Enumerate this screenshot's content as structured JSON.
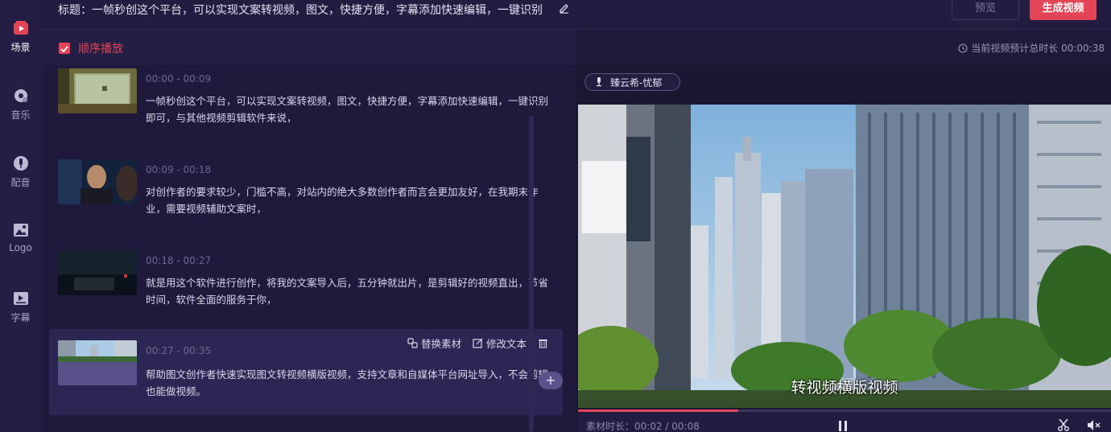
{
  "nav": {
    "items": [
      {
        "label": "场景",
        "icon": "scene-icon",
        "active": true
      },
      {
        "label": "音乐",
        "icon": "music-icon",
        "active": false
      },
      {
        "label": "配音",
        "icon": "voice-icon",
        "active": false
      },
      {
        "label": "Logo",
        "icon": "logo-icon",
        "active": false
      },
      {
        "label": "字幕",
        "icon": "subtitle-icon",
        "active": false
      }
    ]
  },
  "header": {
    "title": "标题：一帧秒创这个平台，可以实现文案转视频，图文，快捷方便，字幕添加快速编辑，一键识别",
    "preview_label": "预览",
    "generate_label": "生成视频"
  },
  "sequence": {
    "label": "顺序播放",
    "checked": true
  },
  "scenes": [
    {
      "time": "00:00 - 00:09",
      "text": "一帧秒创这个平台，可以实现文案转视频，图文，快捷方便，字幕添加快速编辑，一键识别即可，与其他视频剪辑软件来说，"
    },
    {
      "time": "00:09 - 00:18",
      "text": "对创作者的要求较少，门槛不高，对站内的绝大多数创作者而言会更加友好，在我期末作业，需要视频辅助文案时，"
    },
    {
      "time": "00:18 - 00:27",
      "text": "就是用这个软件进行创作，将我的文案导入后，五分钟就出片，是剪辑好的视频直出，节省时间，软件全面的服务于你，"
    },
    {
      "time": "00:27 - 00:35",
      "text": "帮助图文创作者快速实现图文转视频横版视频，支持文章和自媒体平台网址导入，不会剪辑也能做视频。"
    }
  ],
  "scene_actions": {
    "replace_label": "替换素材",
    "edit_label": "修改文本"
  },
  "add_label": "+",
  "preview": {
    "duration_text": "当前视频预计总时长 00:00:38",
    "voice_label": "臻云希-忧郁",
    "subtitle": "转视频横版视频",
    "material_time": "素材时长：00:02 / 00:08",
    "progress": 0.3
  },
  "colors": {
    "accent": "#e34556",
    "background": "#1b1733",
    "panel": "#1f1a3c"
  }
}
